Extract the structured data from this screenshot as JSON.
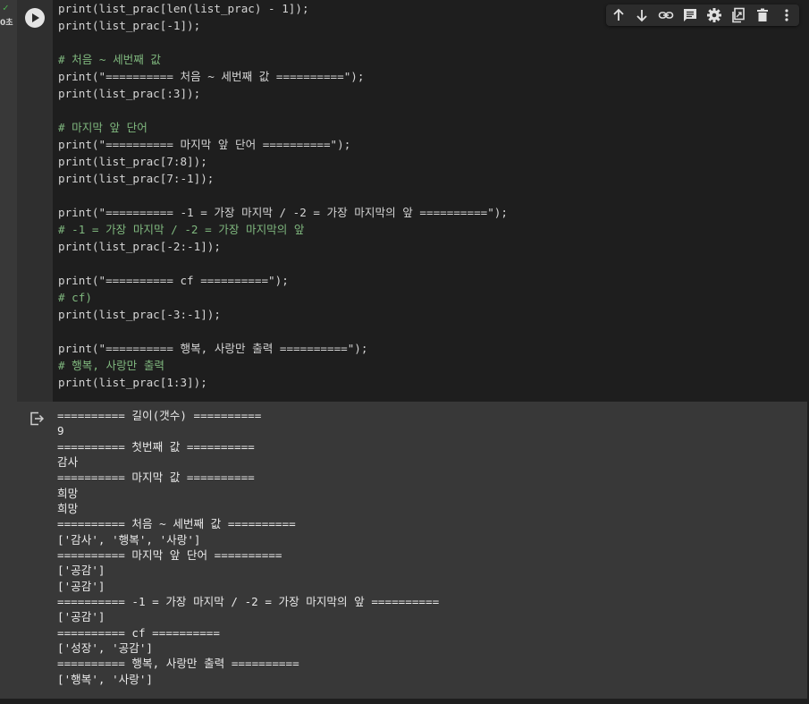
{
  "gutter": {
    "exec_time": "0초"
  },
  "code_lines": [
    "print(list_prac[len(list_prac) - 1]);",
    "print(list_prac[-1]);",
    "",
    "# 처음 ~ 세번째 값",
    "print(\"========== 처음 ~ 세번째 값 ==========\");",
    "print(list_prac[:3]);",
    "",
    "# 마지막 앞 단어",
    "print(\"========== 마지막 앞 단어 ==========\");",
    "print(list_prac[7:8]);",
    "print(list_prac[7:-1]);",
    "",
    "print(\"========== -1 = 가장 마지막 / -2 = 가장 마지막의 앞 ==========\");",
    "# -1 = 가장 마지막 / -2 = 가장 마지막의 앞",
    "print(list_prac[-2:-1]);",
    "",
    "print(\"========== cf ==========\");",
    "# cf)",
    "print(list_prac[-3:-1]);",
    "",
    "print(\"========== 행복, 사랑만 출력 ==========\");",
    "# 행복, 사랑만 출력",
    "print(list_prac[1:3]);"
  ],
  "output_lines": [
    "========== 길이(갯수) ==========",
    "9",
    "========== 첫번째 값 ==========",
    "감사",
    "========== 마지막 값 ==========",
    "희망",
    "희망",
    "========== 처음 ~ 세번째 값 ==========",
    "['감사', '행복', '사랑']",
    "========== 마지막 앞 단어 ==========",
    "['공감']",
    "['공감']",
    "========== -1 = 가장 마지막 / -2 = 가장 마지막의 앞 ==========",
    "['공감']",
    "========== cf ==========",
    "['성장', '공감']",
    "========== 행복, 사랑만 출력 ==========",
    "['행복', '사랑']"
  ],
  "toolbar": {
    "icons": [
      "arrow-up-icon",
      "arrow-down-icon",
      "link-icon",
      "comment-icon",
      "gear-icon",
      "mirror-cell-icon",
      "trash-icon",
      "more-vert-icon"
    ]
  },
  "colors": {
    "editor_bg": "#1e1e1e",
    "cell_bg": "#383838",
    "comment": "#7fb77e",
    "exec_ok": "#4caf50"
  }
}
